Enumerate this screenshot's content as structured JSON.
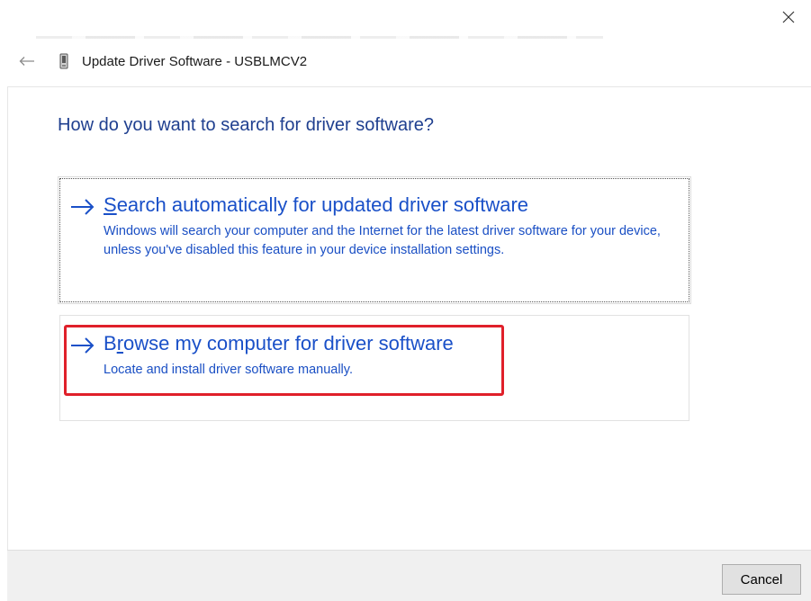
{
  "window": {
    "title": "Update Driver Software - USBLMCV2"
  },
  "icons": {
    "close": "close-icon",
    "back": "back-arrow-icon",
    "device": "usb-device-icon",
    "option_arrow": "right-arrow-icon"
  },
  "main": {
    "heading": "How do you want to search for driver software?",
    "options": [
      {
        "title_accel": "S",
        "title_rest": "earch automatically for updated driver software",
        "description": "Windows will search your computer and the Internet for the latest driver software for your device, unless you've disabled this feature in your device installation settings."
      },
      {
        "title_pre": "B",
        "title_accel": "r",
        "title_rest": "owse my computer for driver software",
        "description": "Locate and install driver software manually."
      }
    ]
  },
  "footer": {
    "cancel_label": "Cancel"
  },
  "colors": {
    "heading": "#1f3f8f",
    "link": "#1a50c8",
    "highlight": "#e0202a",
    "footer_bg": "#f0f0f0"
  }
}
